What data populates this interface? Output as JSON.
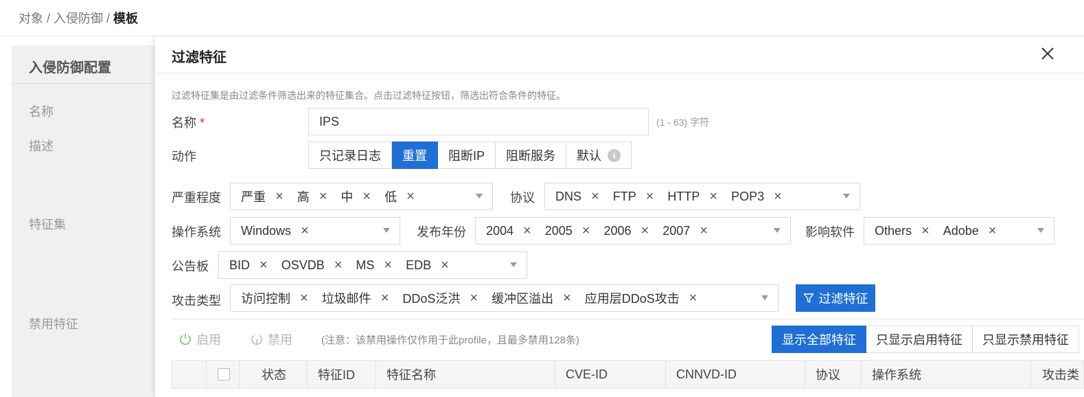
{
  "breadcrumb": {
    "part1": "对象",
    "sep1": " / ",
    "part2": "入侵防御",
    "sep2": " / ",
    "current": "模板"
  },
  "background": {
    "title": "入侵防御配置",
    "labels": [
      "名称",
      "描述",
      "特征集",
      "禁用特征"
    ]
  },
  "drawer": {
    "title": "过滤特征",
    "description": "过滤特征集是由过滤条件筛选出来的特征集合。点击过滤特征按钮，筛选出符合条件的特征。",
    "name": {
      "label": "名称",
      "required_mark": "*",
      "value": "IPS",
      "hint": "(1 - 63) 字符"
    },
    "action": {
      "label": "动作",
      "options": [
        "只记录日志",
        "重置",
        "阻断IP",
        "阻断服务",
        "默认"
      ],
      "selected": "重置"
    },
    "severity": {
      "label": "严重程度",
      "tags": [
        "严重",
        "高",
        "中",
        "低"
      ]
    },
    "protocol": {
      "label": "协议",
      "tags": [
        "DNS",
        "FTP",
        "HTTP",
        "POP3"
      ]
    },
    "os": {
      "label": "操作系统",
      "tags": [
        "Windows"
      ]
    },
    "year": {
      "label": "发布年份",
      "tags": [
        "2004",
        "2005",
        "2006",
        "2007"
      ]
    },
    "software": {
      "label": "影响软件",
      "tags": [
        "Others",
        "Adobe"
      ]
    },
    "bulletin": {
      "label": "公告板",
      "tags": [
        "BID",
        "OSVDB",
        "MS",
        "EDB"
      ]
    },
    "attack": {
      "label": "攻击类型",
      "tags": [
        "访问控制",
        "垃圾邮件",
        "DDoS泛洪",
        "缓冲区溢出",
        "应用层DDoS攻击"
      ]
    },
    "filter_button": "过滤特征",
    "toolbar": {
      "enable": "启用",
      "disable": "禁用",
      "note": "(注意：该禁用操作仅作用于此profile，且最多禁用128条)"
    },
    "view": {
      "options": [
        "显示全部特征",
        "只显示启用特征",
        "只显示禁用特征"
      ],
      "selected": "显示全部特征"
    },
    "table": {
      "columns": [
        "状态",
        "特征ID",
        "特征名称",
        "CVE-ID",
        "CNNVD-ID",
        "协议",
        "操作系统",
        "攻击类"
      ]
    }
  },
  "colors": {
    "primary": "#1f6fd6",
    "required": "#e23"
  }
}
